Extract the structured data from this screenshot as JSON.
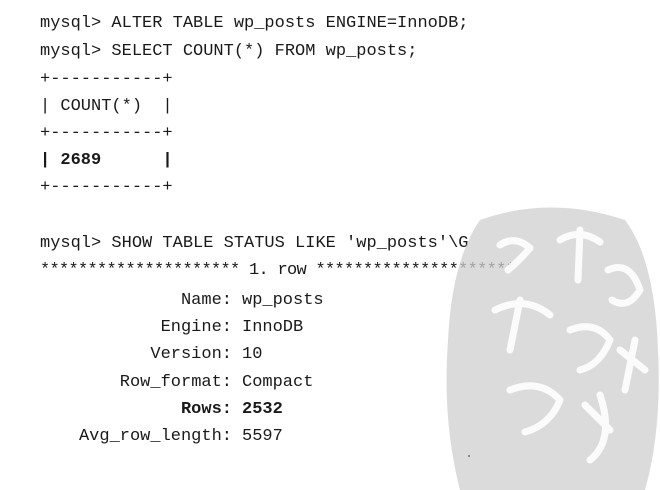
{
  "terminal": {
    "cmd1": "mysql> ALTER TABLE wp_posts ENGINE=InnoDB;",
    "cmd2": "mysql> SELECT COUNT(*) FROM wp_posts;",
    "border": "+-----------+",
    "count_header": "| COUNT(*)  |",
    "count_value": "| 2689      |",
    "cmd3": "mysql> SHOW TABLE STATUS LIKE 'wp_posts'\\G",
    "row_separator": "********************* 1. row *********************"
  },
  "status_fields": [
    {
      "name": "Name:",
      "value": "wp_posts"
    },
    {
      "name": "Engine:",
      "value": "InnoDB"
    },
    {
      "name": "Version:",
      "value": "10"
    },
    {
      "name": "Row_format:",
      "value": "Compact"
    },
    {
      "name": "Rows:",
      "value": "2532"
    },
    {
      "name": "Avg_row_length:",
      "value": "5597"
    }
  ],
  "watermark_color": "#cfcfcf"
}
